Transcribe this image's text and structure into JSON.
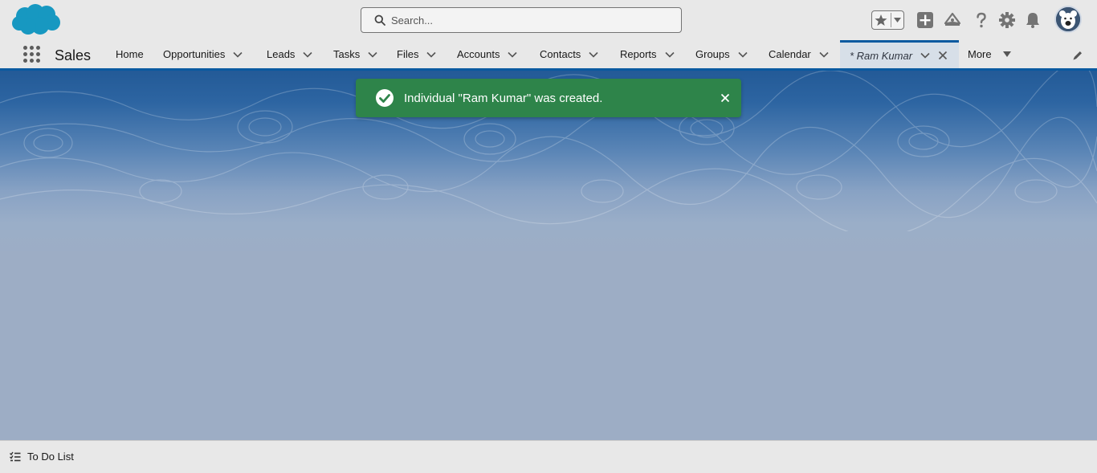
{
  "header": {
    "logo_icon": "salesforce-cloud-logo",
    "search": {
      "placeholder": "Search...",
      "value": ""
    },
    "icons": [
      "favorites-star-icon",
      "global-actions-plus-icon",
      "trailhead-guidance-icon",
      "help-icon",
      "setup-gear-icon",
      "notifications-bell-icon",
      "user-avatar"
    ]
  },
  "nav": {
    "app_name": "Sales",
    "items": [
      {
        "label": "Home",
        "dropdown": false
      },
      {
        "label": "Opportunities",
        "dropdown": true
      },
      {
        "label": "Leads",
        "dropdown": true
      },
      {
        "label": "Tasks",
        "dropdown": true
      },
      {
        "label": "Files",
        "dropdown": true
      },
      {
        "label": "Accounts",
        "dropdown": true
      },
      {
        "label": "Contacts",
        "dropdown": true
      },
      {
        "label": "Reports",
        "dropdown": true
      },
      {
        "label": "Groups",
        "dropdown": true
      },
      {
        "label": "Calendar",
        "dropdown": true
      }
    ],
    "active_tab": {
      "label": "* Ram Kumar"
    },
    "more_label": "More"
  },
  "toast": {
    "message": "Individual \"Ram Kumar\" was created.",
    "color": "#2e844a",
    "icon": "success-check-icon"
  },
  "utility_bar": {
    "todo_label": "To Do List"
  },
  "colors": {
    "brand_blue": "#0a5aa0",
    "header_bg": "#e8e8e8",
    "page_bg": "#9dadc5"
  }
}
